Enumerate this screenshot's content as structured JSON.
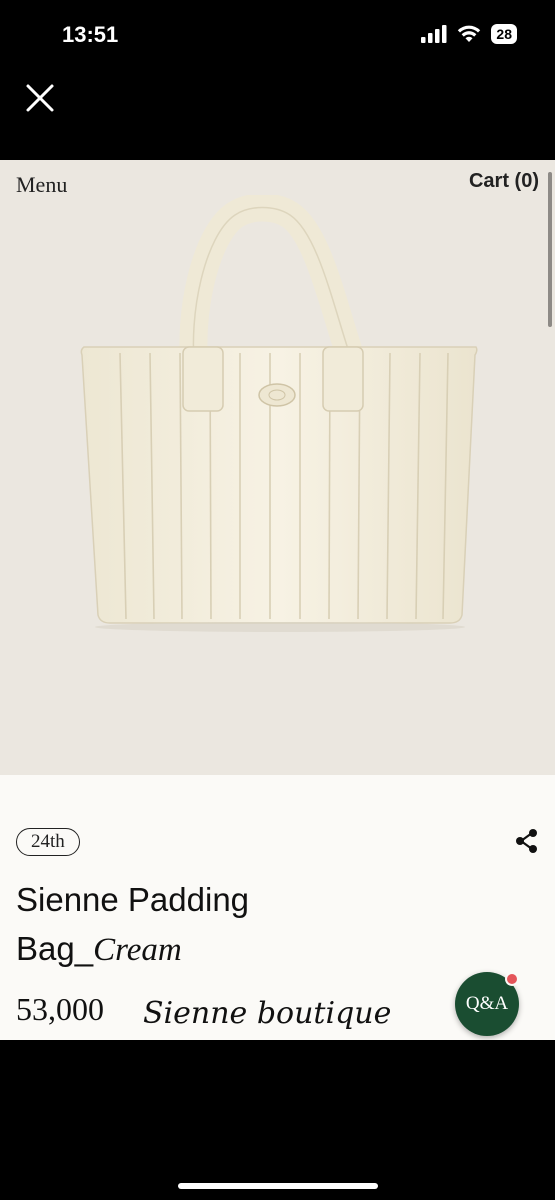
{
  "status_bar": {
    "time": "13:51",
    "battery": "28",
    "icons": [
      "cellular-signal-icon",
      "wifi-icon",
      "battery-icon"
    ]
  },
  "nav": {
    "close_icon": "close-icon",
    "menu_label": "Menu",
    "cart_label": "Cart (0)"
  },
  "product": {
    "image_icon": "tote-bag-image",
    "edition_badge": "24th",
    "title_line1": "Sienne Padding",
    "title_prefix": "Bag_",
    "title_color": "Cream",
    "price": "53,000",
    "brand_signature": "Sienne boutique",
    "share_icon": "share-icon"
  },
  "qa_button": {
    "label": "Q&A",
    "color": "#1a4d31",
    "badge_color": "#e4555a"
  },
  "colors": {
    "hero_background": "#ebe7e0",
    "page_background": "#fbfaf7",
    "bag_cream": "#f4efdf"
  }
}
